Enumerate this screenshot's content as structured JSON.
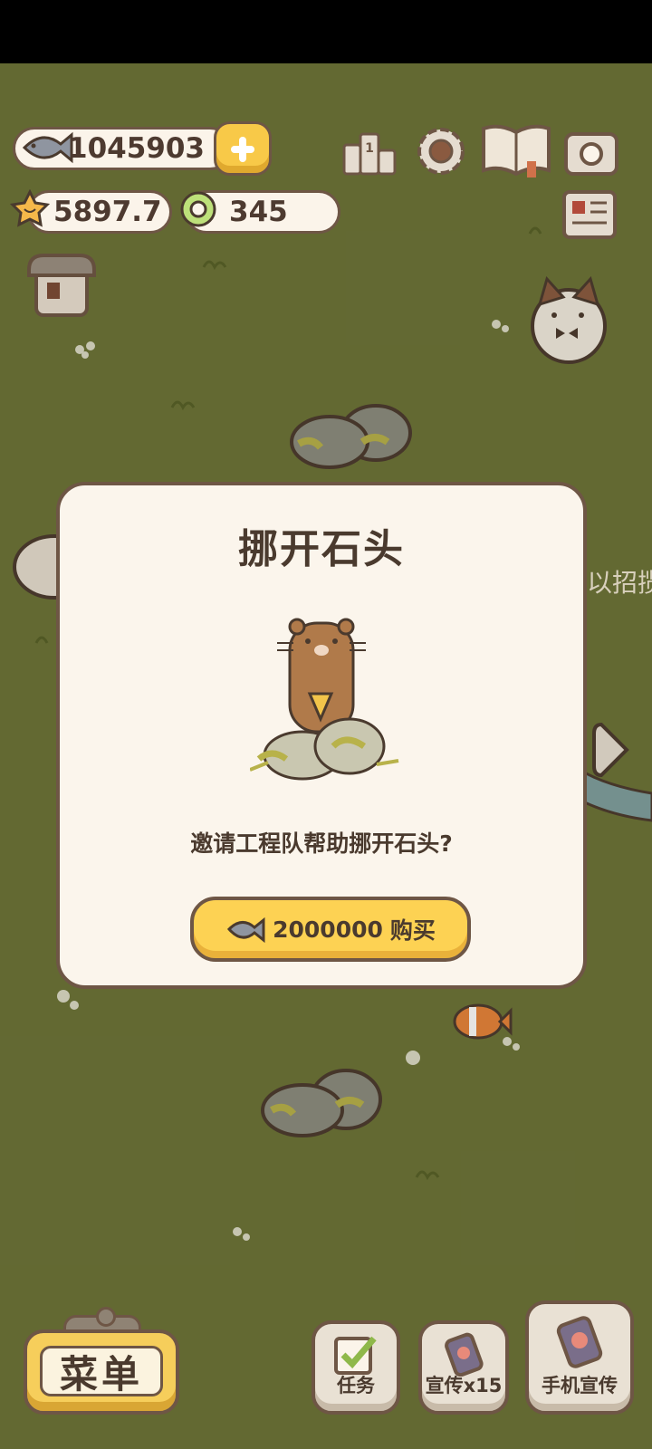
{
  "currencies": {
    "fish": "1045903",
    "stars": "5897.7",
    "gems": "345"
  },
  "top_icons": [
    "ranking-icon",
    "settings-gear-icon",
    "catalog-book-icon",
    "camera-icon",
    "newspaper-icon"
  ],
  "side_hint_text": "以招揽",
  "dialog": {
    "title": "挪开石头",
    "message": "邀请工程队帮助挪开石头?",
    "buy_price": "2000000",
    "buy_label": "购买"
  },
  "bottom_bar": {
    "menu_label": "菜单",
    "tasks_label": "任务",
    "promo_label": "宣传x15",
    "phone_promo_label": "手机宣传"
  },
  "colors": {
    "grass": "#6b7337",
    "panel": "#fbf5ec",
    "outline": "#6e5645",
    "button_yellow": "#fdd253"
  }
}
